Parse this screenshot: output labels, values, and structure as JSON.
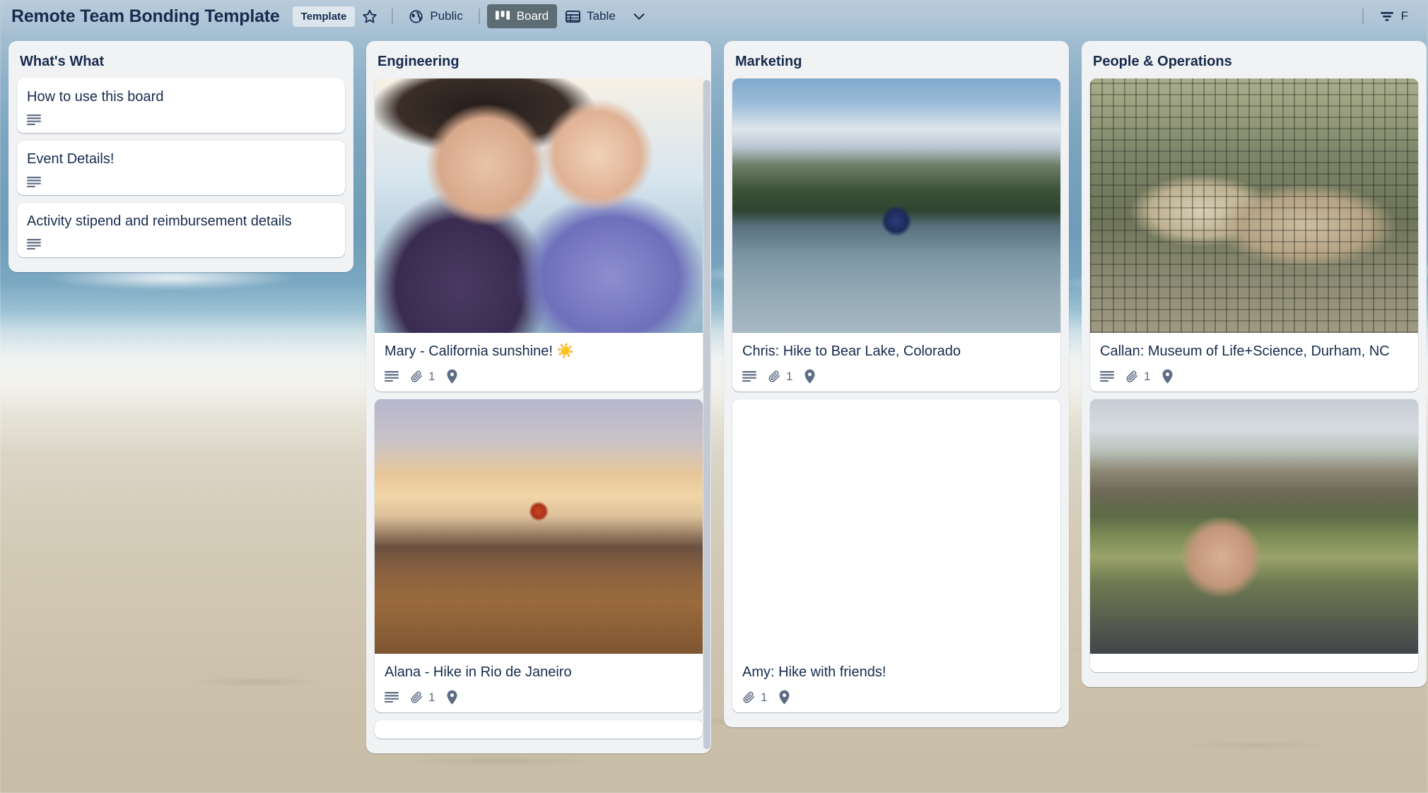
{
  "header": {
    "title": "Remote Team Bonding Template",
    "template_badge": "Template",
    "star_icon": "star-icon",
    "visibility": {
      "icon": "globe-icon",
      "label": "Public"
    },
    "views": [
      {
        "id": "board",
        "icon": "board-icon",
        "label": "Board",
        "active": true
      },
      {
        "id": "table",
        "icon": "table-icon",
        "label": "Table",
        "active": false
      }
    ],
    "views_chevron_icon": "chevron-down-icon",
    "filter": {
      "icon": "filter-icon",
      "label": "F"
    },
    "colors": {
      "text": "#172b4d",
      "active_tab_bg": "#5e6c74",
      "chip_bg": "rgba(255,255,255,0.55)"
    }
  },
  "lists": [
    {
      "title": "What's What",
      "scrollable": false,
      "cards": [
        {
          "title": "How to use this board",
          "cover": null,
          "badges": {
            "description": true,
            "attachments": null,
            "location": false
          }
        },
        {
          "title": "Event Details!",
          "cover": null,
          "badges": {
            "description": true,
            "attachments": null,
            "location": false
          }
        },
        {
          "title": "Activity stipend and reimbursement details",
          "cover": null,
          "badges": {
            "description": true,
            "attachments": null,
            "location": false
          }
        }
      ]
    },
    {
      "title": "Engineering",
      "scrollable": true,
      "cards": [
        {
          "title": "Mary - California sunshine! ☀️",
          "cover": "cover-mary",
          "badges": {
            "description": true,
            "attachments": "1",
            "location": true
          }
        },
        {
          "title": "Alana - Hike in Rio de Janeiro",
          "cover": "cover-alana",
          "badges": {
            "description": true,
            "attachments": "1",
            "location": true
          }
        },
        {
          "title": "",
          "cover": null,
          "badges": {
            "description": false,
            "attachments": null,
            "location": false
          }
        }
      ]
    },
    {
      "title": "Marketing",
      "scrollable": false,
      "cards": [
        {
          "title": "Chris: Hike to Bear Lake, Colorado",
          "cover": "cover-chris",
          "badges": {
            "description": true,
            "attachments": "1",
            "location": true
          }
        },
        {
          "title": "Amy: Hike with friends!",
          "cover": "cover-amy",
          "badges": {
            "description": false,
            "attachments": "1",
            "location": true
          }
        }
      ]
    },
    {
      "title": "People & Operations",
      "scrollable": false,
      "cards": [
        {
          "title": "Callan: Museum of Life+Science, Durham, NC",
          "cover": "cover-callan",
          "badges": {
            "description": true,
            "attachments": "1",
            "location": true
          }
        },
        {
          "title": "",
          "cover": "cover-castle",
          "badges": {
            "description": false,
            "attachments": null,
            "location": false
          }
        }
      ]
    }
  ],
  "icons": {
    "description": "description-icon",
    "attachment": "paperclip-icon",
    "location": "location-pin-icon"
  }
}
